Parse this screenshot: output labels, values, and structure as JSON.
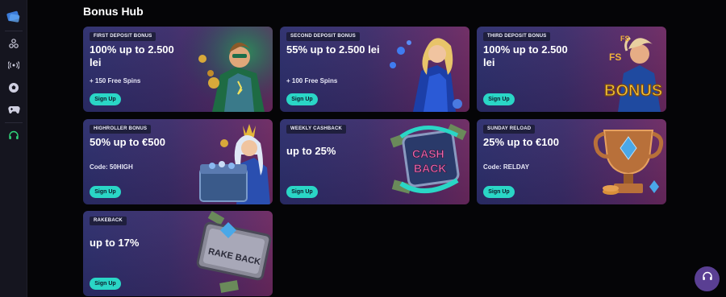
{
  "page": {
    "title": "Bonus Hub"
  },
  "sidebar": {
    "icons": [
      "logo-icon",
      "basketball-icon",
      "live-signal-icon",
      "soccer-ball-icon",
      "gamepad-icon",
      "headset-icon"
    ]
  },
  "cards": [
    {
      "badge": "FIRST DEPOSIT BONUS",
      "headline": "100% up to 2.500 lei",
      "subtext": "+ 150 Free Spins",
      "button": "Sign Up"
    },
    {
      "badge": "SECOND DEPOSIT BONUS",
      "headline": "55% up to 2.500 lei",
      "subtext": "+ 100 Free Spins",
      "button": "Sign Up"
    },
    {
      "badge": "THIRD DEPOSIT BONUS",
      "headline": "100% up to 2.500 lei",
      "subtext": "",
      "button": "Sign Up"
    },
    {
      "badge": "HIGHROLLER BONUS",
      "headline": "50% up to €500",
      "subtext": "Code: 50HIGH",
      "button": "Sign Up"
    },
    {
      "badge": "WEEKLY CASHBACK",
      "headline": "up to 25%",
      "subtext": "",
      "button": "Sign Up"
    },
    {
      "badge": "SUNDAY RELOAD",
      "headline": "25% up to €100",
      "subtext": "Code: RELDAY",
      "button": "Sign Up"
    },
    {
      "badge": "RAKEBACK",
      "headline": "up to 17%",
      "subtext": "",
      "button": "Sign Up"
    }
  ],
  "art_text": {
    "bonus": "BONUS",
    "fs": "FS",
    "cash": "CASH",
    "back": "BACK",
    "rakeback": "RAKE BACK"
  },
  "colors": {
    "accent": "#2ad6c6",
    "support": "#5a3f93",
    "headset_active": "#2fd37a"
  }
}
